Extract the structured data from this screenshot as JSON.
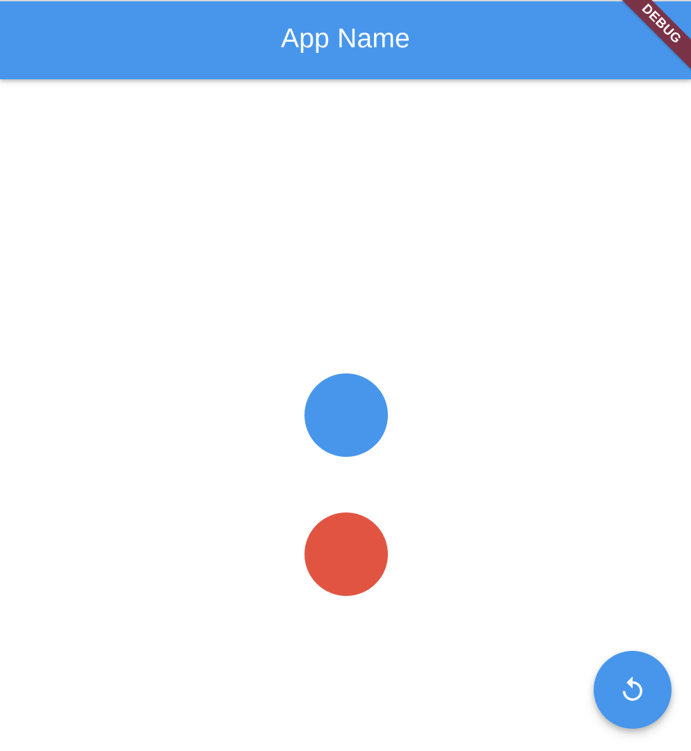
{
  "app_bar": {
    "title": "App Name",
    "color": "#4796ec"
  },
  "debug_banner": {
    "label": "DEBUG",
    "color": "#7a3346"
  },
  "main": {
    "circles": [
      {
        "name": "blue-circle",
        "color": "#4796ec"
      },
      {
        "name": "red-circle",
        "color": "#e25442"
      }
    ]
  },
  "fab": {
    "icon": "replay-icon",
    "color": "#4796ec"
  }
}
